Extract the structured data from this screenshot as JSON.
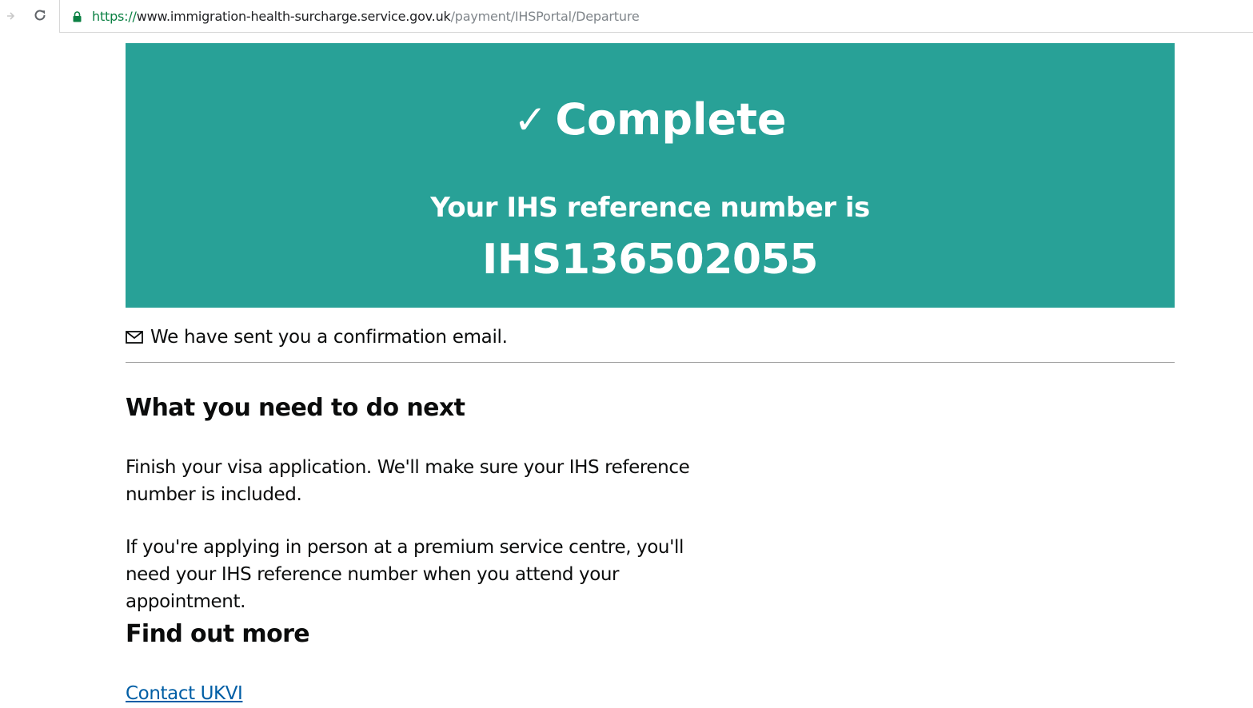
{
  "browser": {
    "url_scheme": "https://",
    "url_host": "www.immigration-health-surcharge.service.gov.uk",
    "url_path": "/payment/IHSPortal/Departure"
  },
  "panel": {
    "check_symbol": "✓",
    "title": "Complete",
    "ref_label": "Your IHS reference number is",
    "ref_number": "IHS136502055",
    "color": "#28a197"
  },
  "email_notice": "We have sent you a confirmation email.",
  "next_steps": {
    "heading": "What you need to do next",
    "paragraph_1": "Finish your visa application. We'll make sure your IHS reference number is included.",
    "paragraph_2": "If you're applying in person at a premium service centre, you'll need your IHS reference number when you attend your appointment."
  },
  "find_out_more": {
    "heading": "Find out more",
    "link_label": "Contact UKVI",
    "link_color": "#005ea5"
  },
  "icons": {
    "forward": "arrow-forward-icon",
    "reload": "reload-icon",
    "lock": "lock-icon",
    "mail": "mail-icon"
  }
}
